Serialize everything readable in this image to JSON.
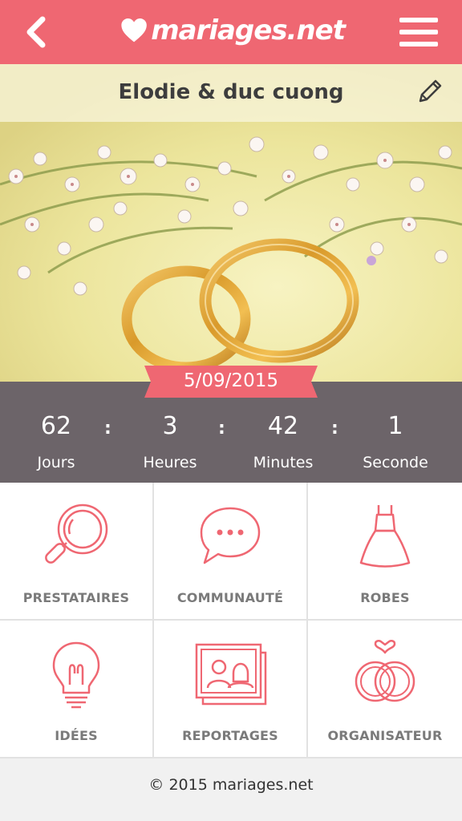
{
  "header": {
    "logo_text": "mariages.net",
    "back_icon": "chevron-left-icon",
    "menu_icon": "hamburger-menu-icon",
    "brand_color": "#ef6772"
  },
  "hero": {
    "couple_name": "Elodie & duc cuong",
    "edit_icon": "pencil-icon",
    "wedding_date": "5/09/2015"
  },
  "countdown": {
    "units": [
      {
        "value": "62",
        "label": "Jours"
      },
      {
        "value": "3",
        "label": "Heures"
      },
      {
        "value": "42",
        "label": "Minutes"
      },
      {
        "value": "1",
        "label": "Seconde"
      }
    ],
    "separator": ":",
    "background_color": "#6c6469"
  },
  "menu_grid": [
    {
      "label": "PRESTATAIRES",
      "icon": "magnifier-icon"
    },
    {
      "label": "COMMUNAUTÉ",
      "icon": "chat-bubble-icon"
    },
    {
      "label": "ROBES",
      "icon": "dress-icon"
    },
    {
      "label": "IDÉES",
      "icon": "lightbulb-icon"
    },
    {
      "label": "REPORTAGES",
      "icon": "photo-album-icon"
    },
    {
      "label": "ORGANISATEUR",
      "icon": "wedding-rings-icon"
    }
  ],
  "footer": {
    "copyright": "© 2015 mariages.net"
  }
}
